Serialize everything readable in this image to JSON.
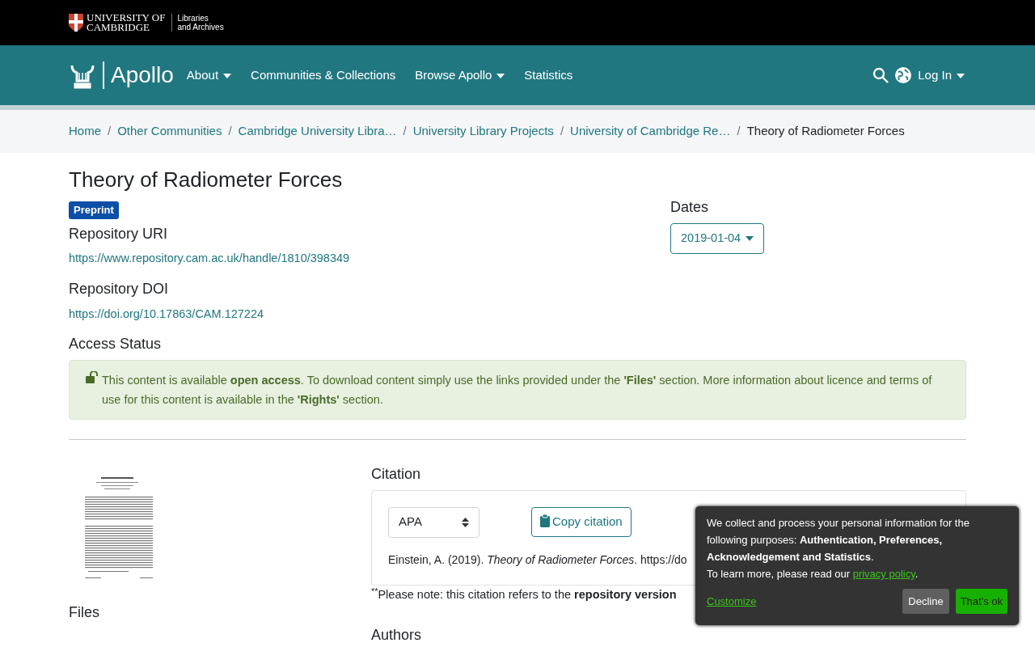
{
  "top_bar": {
    "university": [
      "UNIVERSITY OF",
      "CAMBRIDGE"
    ],
    "unit": [
      "Libraries",
      "and Archives"
    ]
  },
  "navbar": {
    "brand": "Apollo",
    "items": [
      {
        "label": "About",
        "dropdown": true
      },
      {
        "label": "Communities & Collections",
        "dropdown": false
      },
      {
        "label": "Browse Apollo",
        "dropdown": true
      },
      {
        "label": "Statistics",
        "dropdown": false
      }
    ],
    "login": "Log In"
  },
  "breadcrumbs": [
    {
      "label": "Home",
      "current": false
    },
    {
      "separator": "/",
      "label": "Other Communities",
      "current": false
    },
    {
      "separator": "/",
      "label": "Cambridge University Libra…",
      "current": false
    },
    {
      "separator": "/",
      "label": "University Library Projects",
      "current": false
    },
    {
      "separator": "/",
      "label": "University of Cambridge Re…",
      "current": false
    },
    {
      "separator": "/",
      "label": "Theory of Radiometer Forces",
      "current": true
    }
  ],
  "item": {
    "title": "Theory of Radiometer Forces",
    "type_badge": "Preprint",
    "fields": [
      {
        "label": "Repository URI",
        "value": "https://www.repository.cam.ac.uk/handle/1810/398349"
      },
      {
        "label": "Repository DOI",
        "value": "https://doi.org/10.17863/CAM.127224"
      }
    ],
    "dates": {
      "label": "Dates",
      "value": "2019-01-04"
    },
    "access": {
      "label": "Access Status",
      "message": "This content is available **open access**. To download content simply use the links provided under the **'Files'** section. More information about licence and terms of use for this content is available in the **'Rights'** section."
    },
    "citation": {
      "label": "Citation",
      "style": "APA",
      "copy_button": "Copy citation",
      "text": "Einstein, A. (2019). *Theory of Radiometer Forces*. https://do",
      "note": "$^{**}$Please note: this citation refers to the **repository version**"
    },
    "files_label": "Files",
    "authors_label": "Authors"
  },
  "cookie_banner": {
    "message": "We collect and process your personal information for the following purposes: **Authentication, Preferences, Acknowledgement and Statistics**.",
    "learn_more": "To learn more, please read our",
    "policy_link": "privacy policy",
    "period": ".",
    "customize": "Customize",
    "decline": "Decline",
    "accept": "That's ok"
  }
}
